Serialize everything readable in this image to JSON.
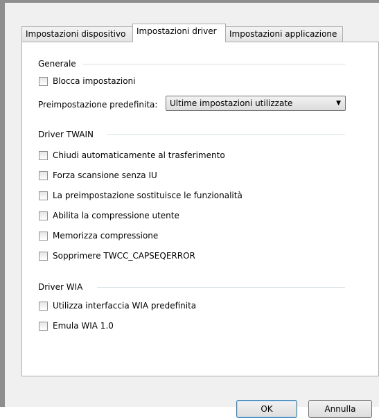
{
  "tabs": [
    {
      "label": "Impostazioni dispositivo",
      "active": false
    },
    {
      "label": "Impostazioni driver",
      "active": true
    },
    {
      "label": "Impostazioni applicazione",
      "active": false
    }
  ],
  "general": {
    "title": "Generale",
    "lock_label": "Blocca impostazioni",
    "preset_label": "Preimpostazione predefinita:",
    "preset_value": "Ultime impostazioni utilizzate"
  },
  "twain": {
    "title": "Driver TWAIN",
    "options": [
      {
        "label": "Chiudi automaticamente al trasferimento",
        "checked": false
      },
      {
        "label": "Forza scansione senza IU",
        "checked": false
      },
      {
        "label": "La preimpostazione sostituisce le funzionalità",
        "checked": false
      },
      {
        "label": "Abilita la compressione utente",
        "checked": false
      },
      {
        "label": "Memorizza compressione",
        "checked": false
      },
      {
        "label": "Sopprimere TWCC_CAPSEQERROR",
        "checked": false
      }
    ]
  },
  "wia": {
    "title": "Driver WIA",
    "options": [
      {
        "label": "Utilizza interfaccia WIA predefinita",
        "checked": false
      },
      {
        "label": "Emula WIA 1.0",
        "checked": false
      }
    ]
  },
  "buttons": {
    "ok": "OK",
    "cancel": "Annulla"
  }
}
